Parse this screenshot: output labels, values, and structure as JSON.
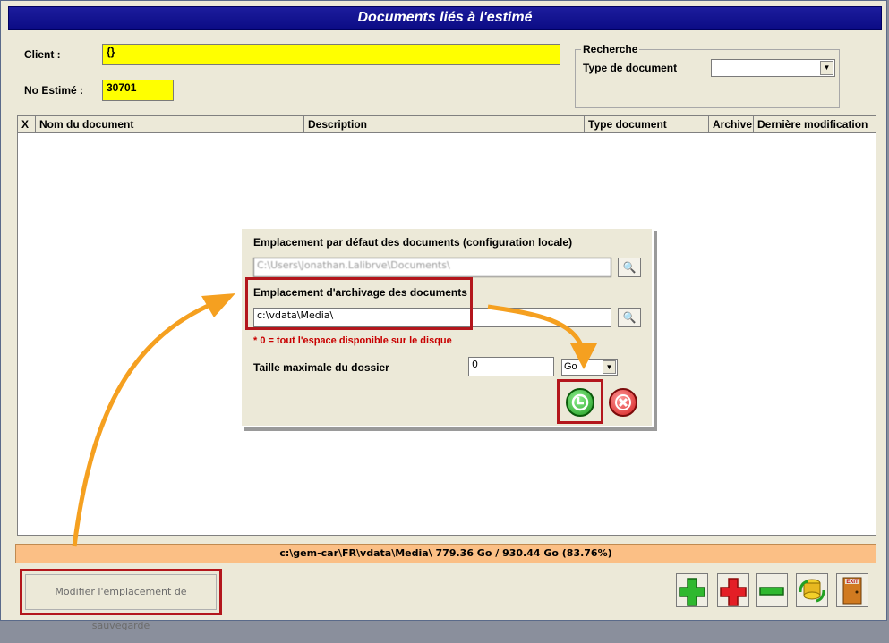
{
  "window": {
    "title": "Documents liés à l'estimé"
  },
  "client": {
    "label": "Client :",
    "value": "{}"
  },
  "estimate": {
    "label": "No Estimé :",
    "value": "30701"
  },
  "search": {
    "group_label": "Recherche",
    "doc_type_label": "Type de document",
    "doc_type_value": ""
  },
  "grid": {
    "columns": [
      "X",
      "Nom du document",
      "Description",
      "Type document",
      "Archive",
      "Dernière modification"
    ],
    "rows": []
  },
  "dialog": {
    "default_location_label": "Emplacement par défaut des documents (configuration locale)",
    "default_location_value": "C:\\Users\\Jonathan.Lalibrve\\Documents\\",
    "archive_location_label": "Emplacement d'archivage des documents",
    "archive_location_value": "c:\\vdata\\Media\\",
    "note": "* 0 = tout l'espace disponible sur le disque",
    "max_size_label": "Taille maximale du dossier",
    "max_size_value": "0",
    "unit_value": "Go"
  },
  "status": {
    "text": "c:\\gem-car\\FR\\vdata\\Media\\   779.36 Go / 930.44 Go (83.76%)"
  },
  "modify_button": {
    "label": "Modifier l'emplacement de sauvegarde"
  },
  "toolbar": {
    "exit_label": "EXIT"
  },
  "colors": {
    "title_bg": "#0c0c86",
    "highlight": "#ffff00",
    "status_bg": "#fbbf85",
    "annotation_red": "#b3161c",
    "arrow_orange": "#f5a020"
  }
}
